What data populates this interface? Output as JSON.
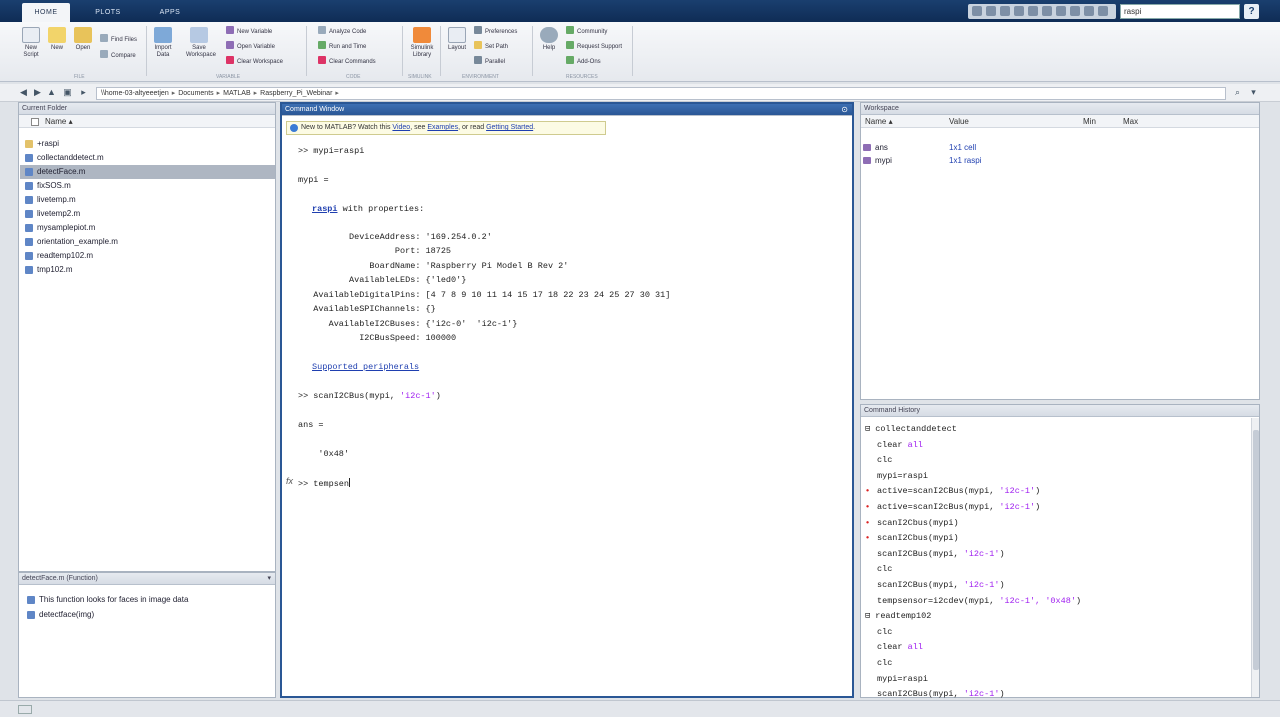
{
  "tabs": [
    {
      "label": "HOME",
      "active": true
    },
    {
      "label": "PLOTS",
      "active": false
    },
    {
      "label": "APPS",
      "active": false
    }
  ],
  "search": {
    "value": "raspi"
  },
  "help_label": "?",
  "ribbon": {
    "file": {
      "new_script": "New Script",
      "new": "New",
      "open": "Open",
      "find_files": "Find Files",
      "compare": "Compare",
      "label": "FILE"
    },
    "variable": {
      "import_data": "Import Data",
      "save_workspace": "Save Workspace",
      "new_variable": "New Variable",
      "open_variable": "Open Variable",
      "clear_workspace": "Clear Workspace",
      "label": "VARIABLE"
    },
    "code": {
      "analyze_code": "Analyze Code",
      "run_and_time": "Run and Time",
      "clear_commands": "Clear Commands",
      "label": "CODE"
    },
    "simulink": {
      "library": "Simulink Library",
      "label": "SIMULINK"
    },
    "environment": {
      "layout": "Layout",
      "preferences": "Preferences",
      "set_path": "Set Path",
      "parallel": "Parallel",
      "label": "ENVIRONMENT"
    },
    "resources": {
      "help": "Help",
      "community": "Community",
      "request_support": "Request Support",
      "add_ons": "Add-Ons",
      "label": "RESOURCES"
    }
  },
  "address": {
    "crumbs": [
      "\\\\home-03-altyeeetjen",
      "Documents",
      "MATLAB",
      "Raspberry_Pi_Webinar"
    ]
  },
  "current_folder": {
    "title": "Current Folder",
    "column_name": "Name ▴",
    "items": [
      {
        "name": "+raspi",
        "type": "folder"
      },
      {
        "name": "collectanddetect.m",
        "type": "file"
      },
      {
        "name": "detectFace.m",
        "type": "file",
        "selected": true
      },
      {
        "name": "fixSOS.m",
        "type": "file"
      },
      {
        "name": "livetemp.m",
        "type": "file"
      },
      {
        "name": "livetemp2.m",
        "type": "file"
      },
      {
        "name": "mysamplepiot.m",
        "type": "file"
      },
      {
        "name": "orientation_example.m",
        "type": "file"
      },
      {
        "name": "readtemp102.m",
        "type": "file"
      },
      {
        "name": "tmp102.m",
        "type": "file"
      }
    ]
  },
  "details": {
    "title": "detectFace.m (Function)",
    "lines": [
      "This function looks for faces in image data",
      "detectface(img)"
    ]
  },
  "command_window": {
    "title": "Command Window",
    "notice": {
      "prefix": "New to MATLAB? Watch this ",
      "video": "Video",
      "mid": ", see ",
      "examples": "Examples",
      "mid2": ", or read ",
      "getting_started": "Getting Started",
      "suffix": "."
    },
    "lines": {
      "l1": ">> mypi=raspi",
      "l2": "mypi =",
      "l3_kw": "raspi",
      "l3_rest": " with properties:",
      "p1": "          DeviceAddress: '169.254.0.2'",
      "p2": "                   Port: 18725",
      "p3": "              BoardName: 'Raspberry Pi Model B Rev 2'",
      "p4": "          AvailableLEDs: {'led0'}",
      "p5": "   AvailableDigitalPins: [4 7 8 9 10 11 14 15 17 18 22 23 24 25 27 30 31]",
      "p6": "   AvailableSPIChannels: {}",
      "p7": "      AvailableI2CBuses: {'i2c-0'  'i2c-1'}",
      "p8": "            I2CBusSpeed: 100000",
      "supported": "Supported peripherals",
      "scan_cmd": ">> scanI2CBus(mypi, ",
      "scan_arg": "'i2c-1'",
      "scan_end": ")",
      "ans": "ans =",
      "ans_val": "    '0x48'",
      "fx": "fx",
      "prompt": ">> tempsen"
    }
  },
  "workspace": {
    "title": "Workspace",
    "columns": [
      "Name ▴",
      "Value",
      "Min",
      "Max"
    ],
    "rows": [
      {
        "name": "ans",
        "value": "1x1 cell"
      },
      {
        "name": "mypi",
        "value": "1x1 raspi"
      }
    ]
  },
  "history": {
    "title": "Command History",
    "rows": [
      {
        "group": true,
        "text": "collectanddetect"
      },
      {
        "text": "clear ",
        "str": "all"
      },
      {
        "text": "clc"
      },
      {
        "text": "mypi=raspi"
      },
      {
        "err": true,
        "text": "active=scanI2CBus(mypi, ",
        "str": "'i2c-1'",
        "end": ")"
      },
      {
        "err": true,
        "text": "active=scanI2cBus(mypi, ",
        "str": "'i2c-1'",
        "end": ")"
      },
      {
        "err": true,
        "text": "scanI2Cbus(mypi)"
      },
      {
        "err": true,
        "text": "scanI2Cbus(mypi)"
      },
      {
        "text": "scanI2CBus(mypi, ",
        "str": "'i2c-1'",
        "end": ")"
      },
      {
        "text": "clc"
      },
      {
        "text": "scanI2CBus(mypi, ",
        "str": "'i2c-1'",
        "end": ")"
      },
      {
        "text": "tempsensor=i2cdev(mypi, ",
        "str": "'i2c-1', '0x48'",
        "end": ")"
      },
      {
        "group": true,
        "text": "readtemp102"
      },
      {
        "text": "clc"
      },
      {
        "text": "clear ",
        "str": "all"
      },
      {
        "text": "clc"
      },
      {
        "text": "mypi=raspi"
      },
      {
        "text": "scanI2CBus(mypi, ",
        "str": "'i2c-1'",
        "end": ")"
      }
    ]
  }
}
